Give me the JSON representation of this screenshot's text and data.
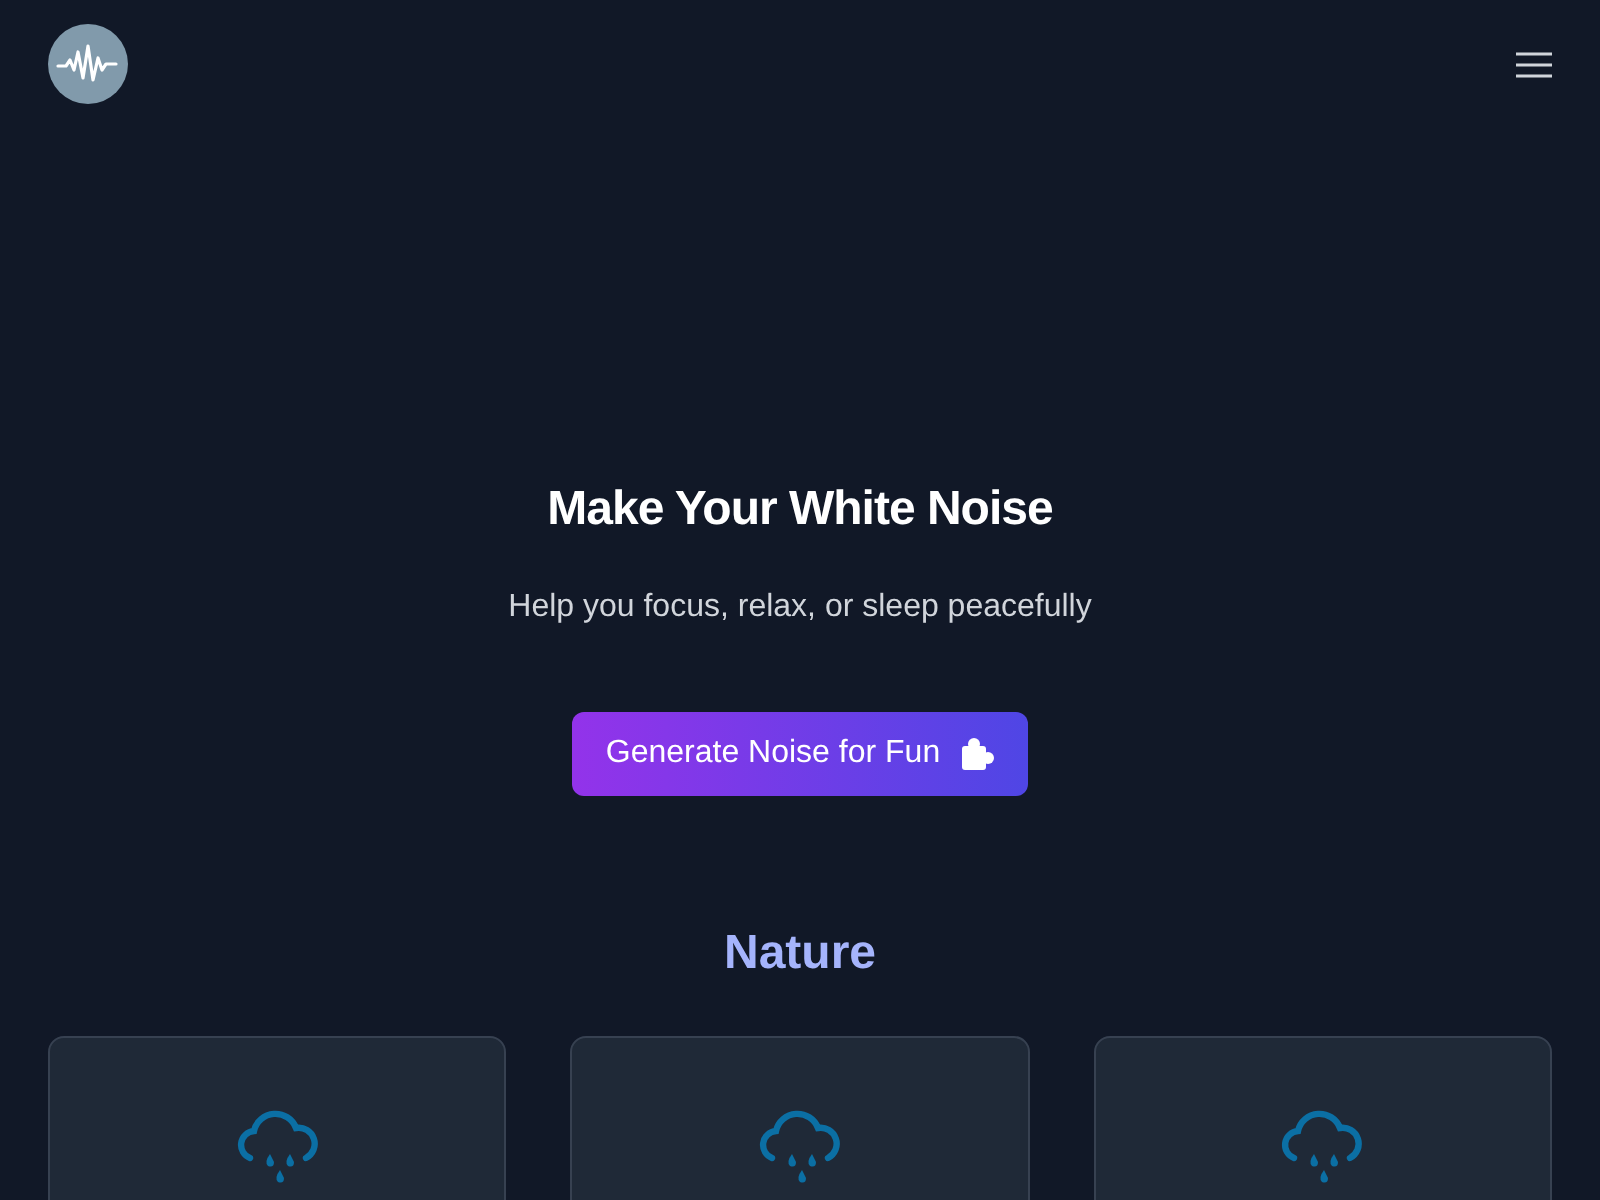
{
  "hero": {
    "title": "Make Your White Noise",
    "subtitle": "Help you focus, relax, or sleep peacefully",
    "button": "Generate Noise for Fun"
  },
  "sections": [
    {
      "heading": "Nature",
      "cards": [
        {
          "kind": "rain"
        },
        {
          "kind": "rain"
        },
        {
          "kind": "rain"
        }
      ]
    }
  ]
}
